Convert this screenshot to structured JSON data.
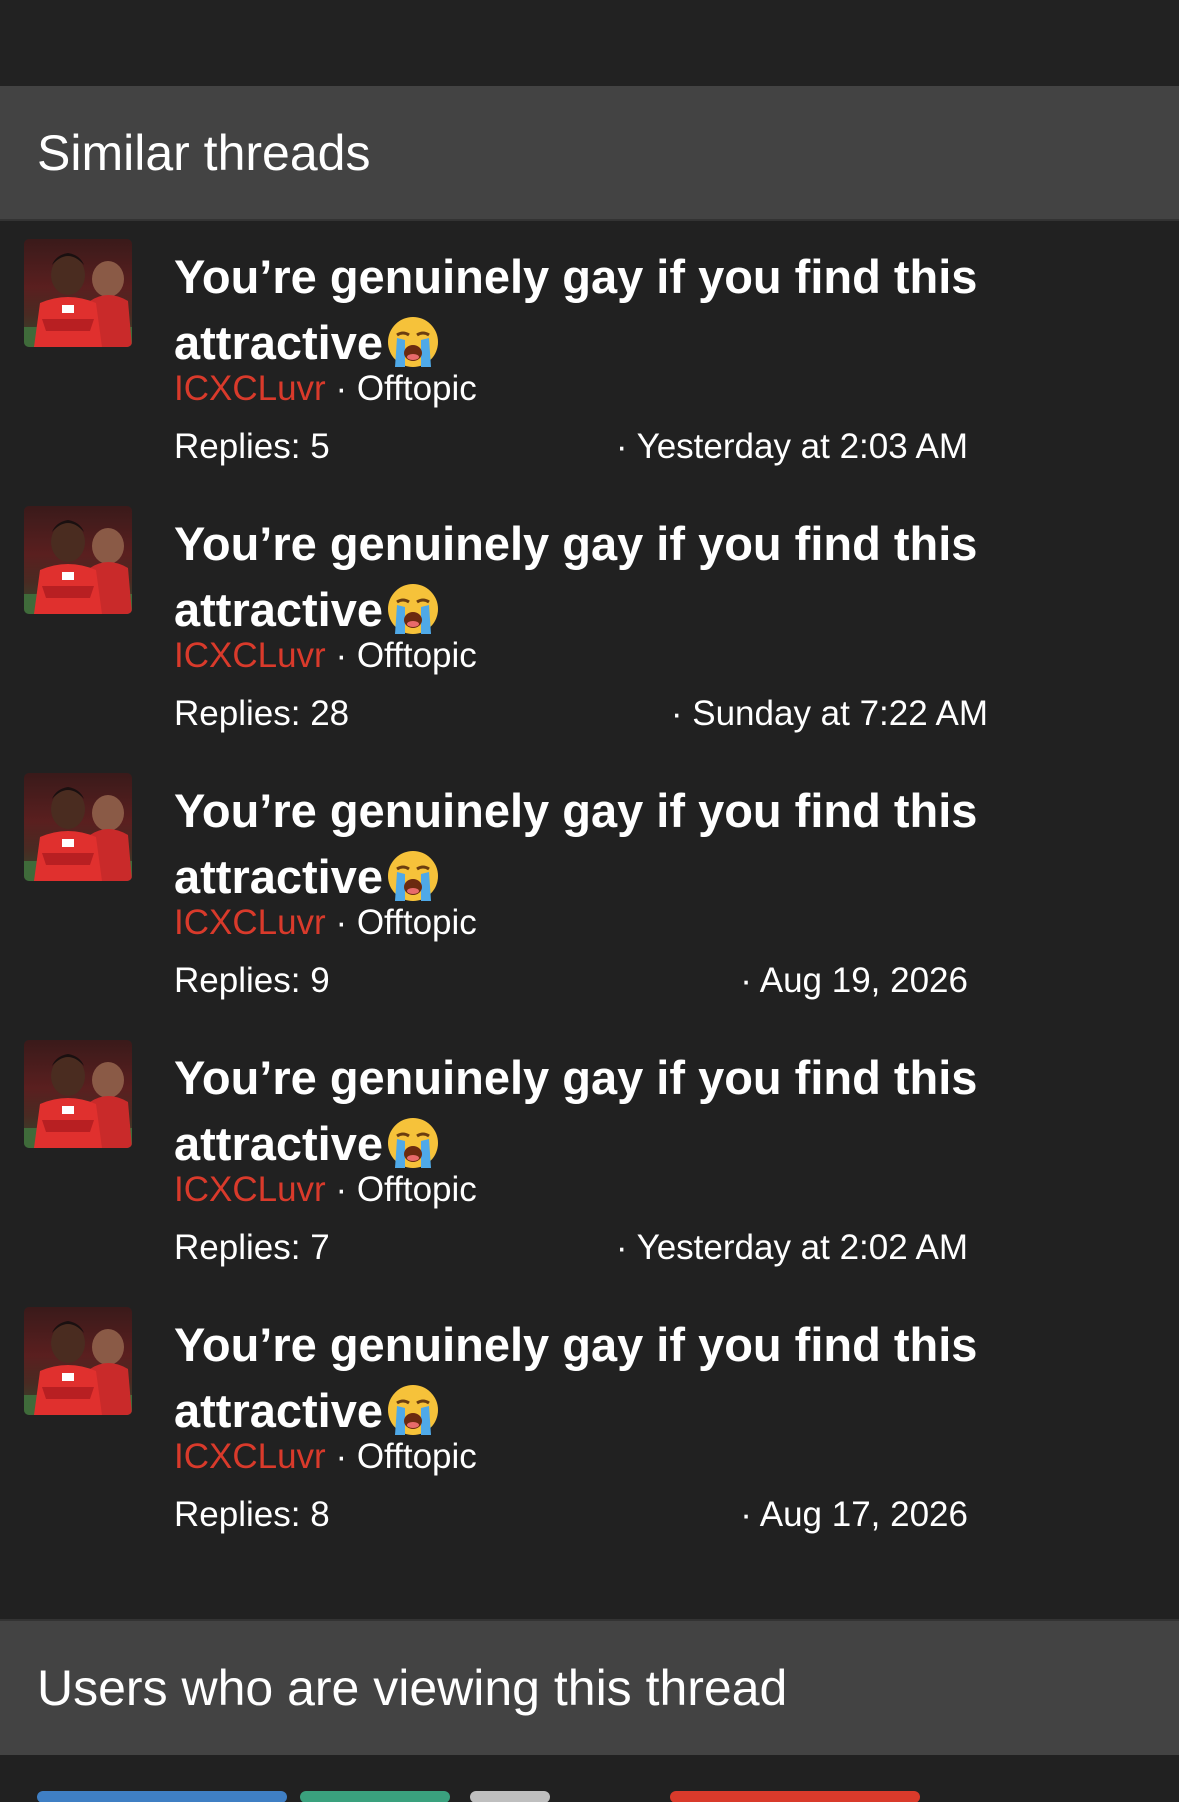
{
  "sections": {
    "similar_threads": "Similar threads",
    "users_viewing": "Users who are viewing this thread"
  },
  "threads": [
    {
      "title": "You’re genuinely gay if you find this attractive",
      "emoji": "loudly-crying-face",
      "author": "ICXCLuvr",
      "forum": "Offtopic",
      "replies_label": "Replies:",
      "replies": "5",
      "date": "· Yesterday at 2:03 AM"
    },
    {
      "title": "You’re genuinely gay if you find this attractive",
      "emoji": "loudly-crying-face",
      "author": "ICXCLuvr",
      "forum": "Offtopic",
      "replies_label": "Replies:",
      "replies": "28",
      "date": "· Sunday at 7:22 AM"
    },
    {
      "title": "You’re genuinely gay if you find this attractive",
      "emoji": "loudly-crying-face",
      "author": "ICXCLuvr",
      "forum": "Offtopic",
      "replies_label": "Replies:",
      "replies": "9",
      "date": "· Aug 19, 2026"
    },
    {
      "title": "You’re genuinely gay if you find this attractive",
      "emoji": "loudly-crying-face",
      "author": "ICXCLuvr",
      "forum": "Offtopic",
      "replies_label": "Replies:",
      "replies": "7",
      "date": "· Yesterday at 2:02 AM"
    },
    {
      "title": "You’re genuinely gay if you find this attractive",
      "emoji": "loudly-crying-face",
      "author": "ICXCLuvr",
      "forum": "Offtopic",
      "replies_label": "Replies:",
      "replies": "8",
      "date": "· Aug 17, 2026"
    }
  ],
  "colors": {
    "background": "#212121",
    "header_bar": "#434343",
    "username_red": "#d93a2b",
    "text": "#ffffff"
  }
}
